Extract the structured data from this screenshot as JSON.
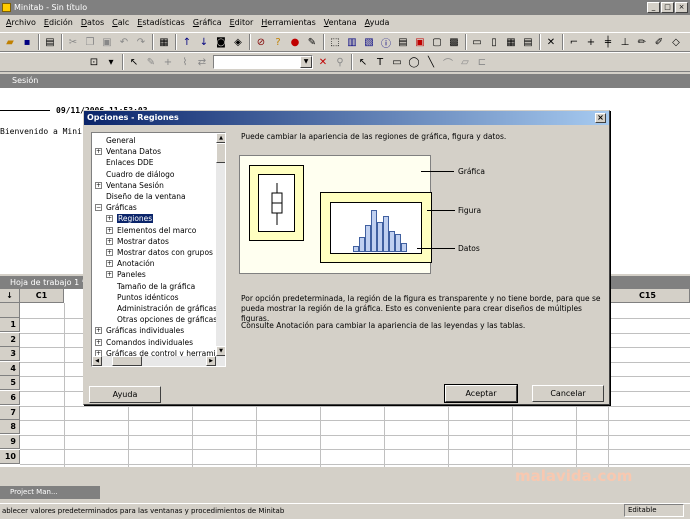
{
  "window": {
    "title": "Minitab - Sin título"
  },
  "menu": [
    "Archivo",
    "Edición",
    "Datos",
    "Calc",
    "Estadísticas",
    "Gráfica",
    "Editor",
    "Herramientas",
    "Ventana",
    "Ayuda"
  ],
  "session": {
    "title": "Sesión",
    "date": "09/11/2006 11:53:03",
    "welcome": "Bienvenido a Mini"
  },
  "worksheet": {
    "title": "Hoja de trabajo 1 ***",
    "corner": "↓",
    "columns": [
      "C1",
      "C15"
    ],
    "rows": [
      "1",
      "2",
      "3",
      "4",
      "5",
      "6",
      "7",
      "8",
      "9",
      "10"
    ]
  },
  "project_manager": {
    "label": "Project Man..."
  },
  "status": {
    "text": "ablecer valores predeterminados para las ventanas y procedimientos de Minitab",
    "mode": "Editable"
  },
  "watermark": "malavida.com",
  "dialog": {
    "title": "Opciones - Regiones",
    "close": "×",
    "tree": [
      {
        "label": "General",
        "level": 0,
        "exp": ""
      },
      {
        "label": "Ventana Datos",
        "level": 0,
        "exp": "+"
      },
      {
        "label": "Enlaces DDE",
        "level": 0,
        "exp": ""
      },
      {
        "label": "Cuadro de diálogo",
        "level": 0,
        "exp": ""
      },
      {
        "label": "Ventana Sesión",
        "level": 0,
        "exp": "+"
      },
      {
        "label": "Diseño de la ventana",
        "level": 0,
        "exp": ""
      },
      {
        "label": "Gráficas",
        "level": 0,
        "exp": "−"
      },
      {
        "label": "Regiones",
        "level": 1,
        "exp": "+",
        "selected": true
      },
      {
        "label": "Elementos del marco",
        "level": 1,
        "exp": "+"
      },
      {
        "label": "Mostrar datos",
        "level": 1,
        "exp": "+"
      },
      {
        "label": "Mostrar datos con grupos",
        "level": 1,
        "exp": "+"
      },
      {
        "label": "Anotación",
        "level": 1,
        "exp": "+"
      },
      {
        "label": "Paneles",
        "level": 1,
        "exp": "+"
      },
      {
        "label": "Tamaño de la gráfica",
        "level": 1,
        "exp": ""
      },
      {
        "label": "Puntos idénticos",
        "level": 1,
        "exp": ""
      },
      {
        "label": "Administración de gráficas",
        "level": 1,
        "exp": ""
      },
      {
        "label": "Otras opciones de gráficas",
        "level": 1,
        "exp": ""
      },
      {
        "label": "Gráficas individuales",
        "level": 0,
        "exp": "+"
      },
      {
        "label": "Comandos individuales",
        "level": 0,
        "exp": "+"
      },
      {
        "label": "Gráficas de control y herramientas",
        "level": 0,
        "exp": "+"
      }
    ],
    "description": "Puede cambiar la apariencia de las regiones de gráfica, figura y datos.",
    "preview": {
      "graph_label": "Gráfica",
      "figure_label": "Figura",
      "data_label": "Datos",
      "histogram": [
        2,
        5,
        9,
        14,
        10,
        12,
        7,
        6,
        3
      ]
    },
    "paragraph1": "Por opción predeterminada, la región de la figura es transparente y no tiene borde, para que se pueda mostrar la región de la gráfica. Esto es conveniente para crear diseños de múltiples figuras.",
    "paragraph2": "Consulte Anotación para cambiar la apariencia de las leyendas y las tablas.",
    "buttons": {
      "help": "Ayuda",
      "ok": "Aceptar",
      "cancel": "Cancelar"
    }
  }
}
